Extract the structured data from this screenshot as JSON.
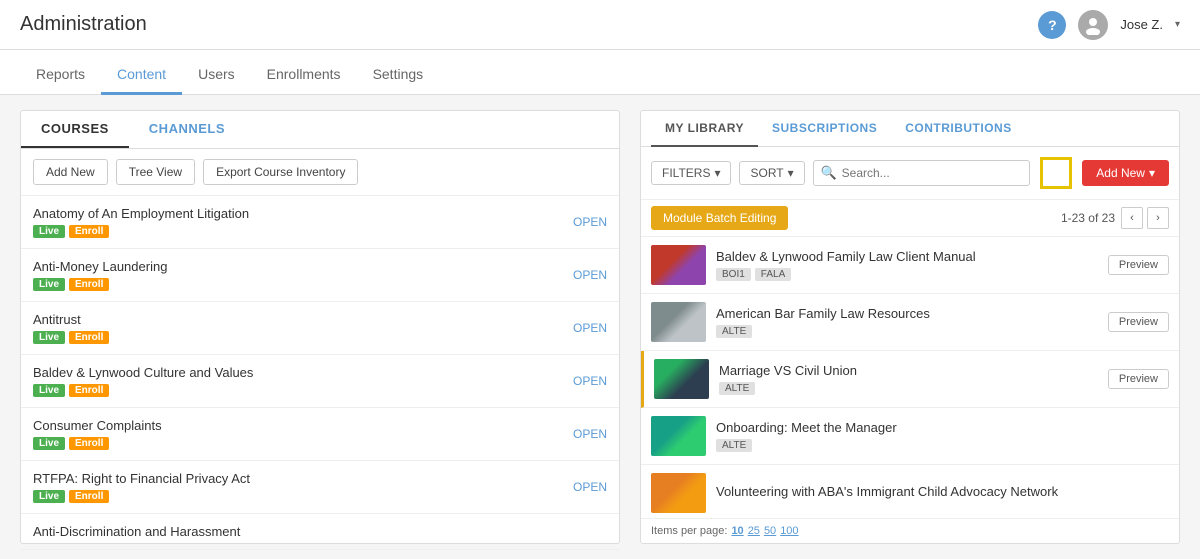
{
  "header": {
    "title": "Administration",
    "help_label": "?",
    "user_name": "Jose Z.",
    "chevron": "▾"
  },
  "nav": {
    "tabs": [
      {
        "id": "reports",
        "label": "Reports",
        "active": false
      },
      {
        "id": "content",
        "label": "Content",
        "active": true
      },
      {
        "id": "users",
        "label": "Users",
        "active": false
      },
      {
        "id": "enrollments",
        "label": "Enrollments",
        "active": false
      },
      {
        "id": "settings",
        "label": "Settings",
        "active": false
      }
    ]
  },
  "left_panel": {
    "tabs": [
      {
        "id": "courses",
        "label": "COURSES",
        "active": true
      },
      {
        "id": "channels",
        "label": "CHANNELS",
        "active": false
      }
    ],
    "toolbar": {
      "add_new": "Add New",
      "tree_view": "Tree View",
      "export": "Export Course Inventory"
    },
    "courses": [
      {
        "title": "Anatomy of An Employment Litigation",
        "badges": [
          "Live",
          "Enroll"
        ],
        "link": "OPEN"
      },
      {
        "title": "Anti-Money Laundering",
        "badges": [
          "Live",
          "Enroll"
        ],
        "link": "OPEN"
      },
      {
        "title": "Antitrust",
        "badges": [
          "Live",
          "Enroll"
        ],
        "link": "OPEN"
      },
      {
        "title": "Baldev & Lynwood Culture and Values",
        "badges": [
          "Live",
          "Enroll"
        ],
        "link": "OPEN"
      },
      {
        "title": "Consumer Complaints",
        "badges": [
          "Live",
          "Enroll"
        ],
        "link": "OPEN"
      },
      {
        "title": "RTFPA: Right to Financial Privacy Act",
        "badges": [
          "Live",
          "Enroll"
        ],
        "link": "OPEN"
      },
      {
        "title": "Anti-Discrimination and Harassment",
        "badges": [],
        "link": ""
      }
    ]
  },
  "right_panel": {
    "tabs": [
      {
        "id": "my-library",
        "label": "MY LIBRARY",
        "active": true
      },
      {
        "id": "subscriptions",
        "label": "SUBSCRIPTIONS",
        "active": false
      },
      {
        "id": "contributions",
        "label": "CONTRIBUTIONS",
        "active": false
      }
    ],
    "filters_label": "FILTERS",
    "sort_label": "SORT",
    "search_placeholder": "Search...",
    "add_new_label": "Add New",
    "batch_editing_label": "Module Batch Editing",
    "pagination": "1-23 of 23",
    "items_per_page_label": "Items per page:",
    "per_page_options": [
      "10",
      "25",
      "50",
      "100"
    ],
    "items": [
      {
        "id": "baldev-lynwood",
        "title": "Baldev & Lynwood Family Law Client Manual",
        "tags": [
          "BOI1",
          "FALA"
        ],
        "thumb_class": "thumb-baldev",
        "preview_label": "Preview",
        "highlighted": false
      },
      {
        "id": "american-bar",
        "title": "American Bar Family Law Resources",
        "tags": [
          "ALTE"
        ],
        "thumb_class": "thumb-american",
        "preview_label": "Preview",
        "highlighted": false
      },
      {
        "id": "marriage-civil",
        "title": "Marriage VS Civil Union",
        "tags": [
          "ALTE"
        ],
        "thumb_class": "thumb-marriage",
        "preview_label": "Preview",
        "highlighted": true
      },
      {
        "id": "onboarding",
        "title": "Onboarding: Meet the Manager",
        "tags": [
          "ALTE"
        ],
        "thumb_class": "thumb-onboarding",
        "preview_label": "",
        "highlighted": false
      },
      {
        "id": "volunteering",
        "title": "Volunteering with ABA's Immigrant Child Advocacy Network",
        "tags": [],
        "thumb_class": "thumb-volunteering",
        "preview_label": "",
        "highlighted": false
      }
    ]
  }
}
